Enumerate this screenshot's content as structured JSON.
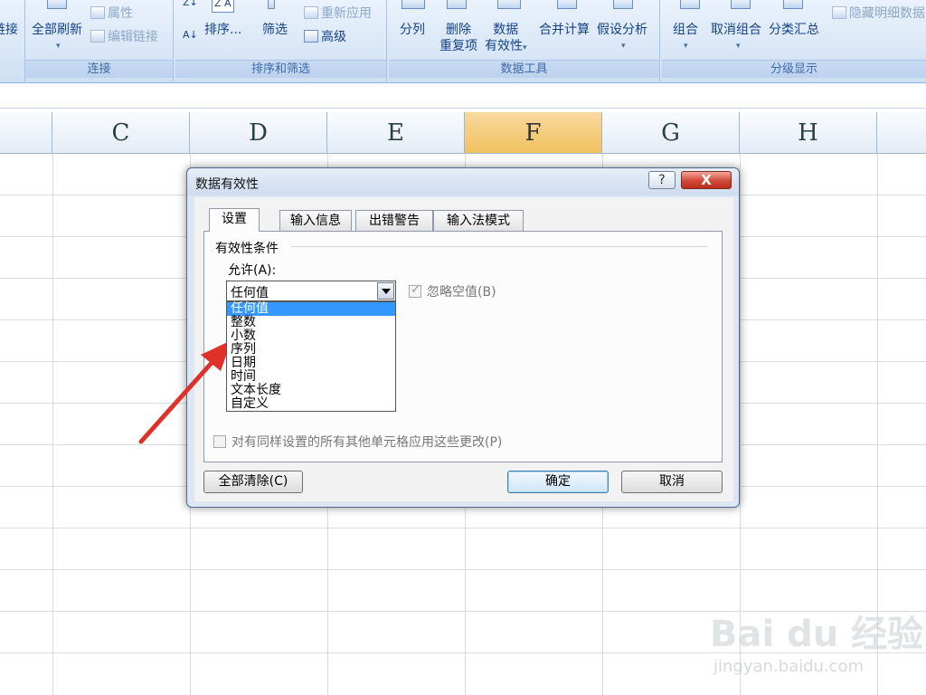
{
  "ribbon": {
    "groups": {
      "connections": {
        "label": "连接",
        "cut_label": "链接",
        "refresh_all": "全部刷新",
        "properties": "属性",
        "edit_links": "编辑链接"
      },
      "sort_filter": {
        "label": "排序和筛选",
        "sort": "排序...",
        "filter": "筛选",
        "reapply": "重新应用",
        "advanced": "高级"
      },
      "data_tools": {
        "label": "数据工具",
        "text_to_columns": "分列",
        "remove_duplicates_line1": "删除",
        "remove_duplicates_line2": "重复项",
        "data_validation_line1": "数据",
        "data_validation_line2": "有效性",
        "consolidate": "合并计算",
        "what_if": "假设分析"
      },
      "outline": {
        "label": "分级显示",
        "group": "组合",
        "ungroup": "取消组合",
        "subtotal": "分类汇总",
        "hide_detail": "隐藏明细数据"
      }
    }
  },
  "sheet": {
    "columns": [
      "C",
      "D",
      "E",
      "F",
      "G",
      "H"
    ],
    "selected_column": "F"
  },
  "dialog": {
    "title": "数据有效性",
    "help_label": "?",
    "close_label": "X",
    "tabs": [
      "设置",
      "输入信息",
      "出错警告",
      "输入法模式"
    ],
    "active_tab": "设置",
    "section_label": "有效性条件",
    "allow_label": "允许(A):",
    "allow_value": "任何值",
    "allow_options": [
      "任何值",
      "整数",
      "小数",
      "序列",
      "日期",
      "时间",
      "文本长度",
      "自定义"
    ],
    "ignore_blank_label": "忽略空值(B)",
    "ignore_blank_checked": true,
    "apply_all_label": "对有同样设置的所有其他单元格应用这些更改(P)",
    "apply_all_checked": false,
    "clear_all_button": "全部清除(C)",
    "ok_button": "确定",
    "cancel_button": "取消"
  },
  "annotation": {
    "color": "#e0302a"
  },
  "watermark": {
    "brand": "Bai du 经验",
    "url": "jingyan.baidu.com"
  }
}
